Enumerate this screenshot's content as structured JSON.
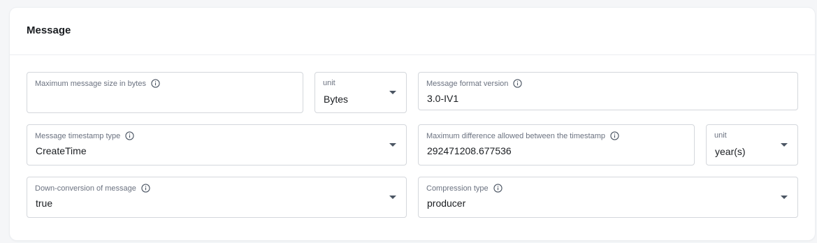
{
  "section": {
    "title": "Message"
  },
  "fields": {
    "max_message_size": {
      "label": "Maximum message size in bytes",
      "value": ""
    },
    "max_message_size_unit": {
      "label": "unit",
      "value": "Bytes"
    },
    "message_format_version": {
      "label": "Message format version",
      "value": "3.0-IV1"
    },
    "message_timestamp_type": {
      "label": "Message timestamp type",
      "value": "CreateTime"
    },
    "max_timestamp_difference": {
      "label": "Maximum difference allowed between the timestamp",
      "value": "292471208.677536"
    },
    "max_timestamp_difference_unit": {
      "label": "unit",
      "value": "year(s)"
    },
    "down_conversion": {
      "label": "Down-conversion of message",
      "value": "true"
    },
    "compression_type": {
      "label": "Compression type",
      "value": "producer"
    }
  },
  "icons": {
    "info": "info-icon",
    "dropdown": "chevron-down-icon"
  },
  "colors": {
    "border": "#d4d7dc",
    "label": "#6b7280",
    "text": "#1a1d21",
    "background": "#f5f6f8"
  }
}
